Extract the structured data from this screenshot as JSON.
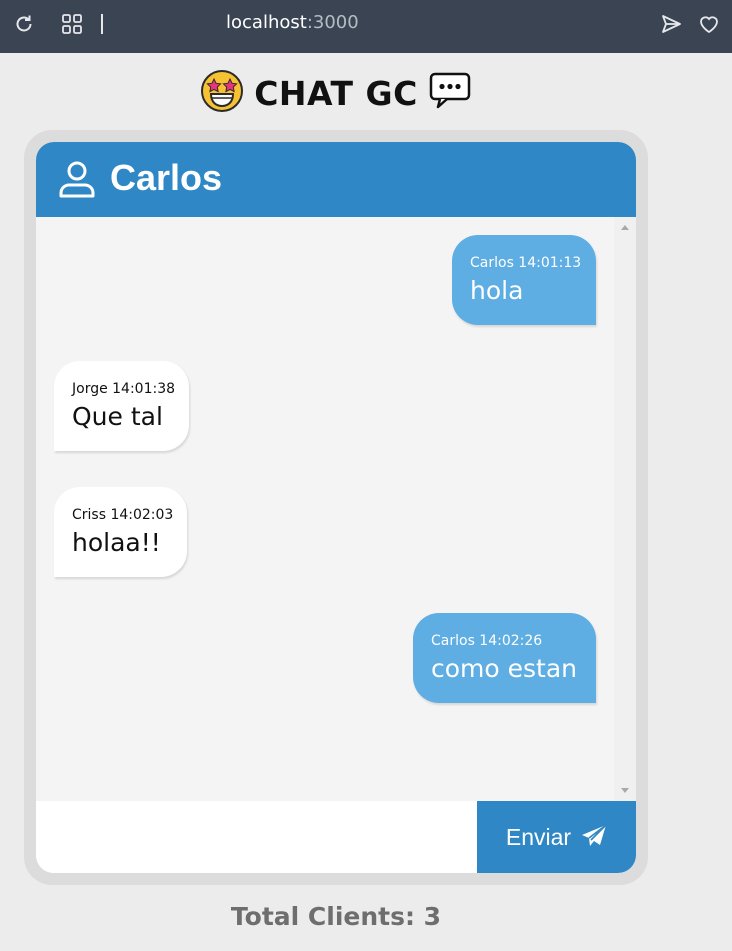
{
  "browser": {
    "url_host": "localhost",
    "url_port": ":3000"
  },
  "app": {
    "title": "CHAT GC",
    "title_emoji": "star-struck-face",
    "title_icon": "speech-bubble-icon"
  },
  "chat": {
    "username": "Carlos",
    "messages": [
      {
        "author": "Carlos",
        "time": "14:01:13",
        "meta": "Carlos 14:01:13",
        "text": "hola",
        "direction": "out"
      },
      {
        "author": "Jorge",
        "time": "14:01:38",
        "meta": "Jorge 14:01:38",
        "text": "Que tal",
        "direction": "in"
      },
      {
        "author": "Criss",
        "time": "14:02:03",
        "meta": "Criss 14:02:03",
        "text": "holaa!!",
        "direction": "in"
      },
      {
        "author": "Carlos",
        "time": "14:02:26",
        "meta": "Carlos 14:02:26",
        "text": "como estan",
        "direction": "out"
      }
    ],
    "input_value": "",
    "send_label": "Enviar"
  },
  "footer": {
    "total_clients": "Total Clients: 3"
  },
  "colors": {
    "header_blue": "#2f87c6",
    "outgoing_bubble": "#5eade3",
    "incoming_bubble": "#ffffff",
    "page_bg": "#ececec",
    "browser_bar": "#3a4452"
  }
}
